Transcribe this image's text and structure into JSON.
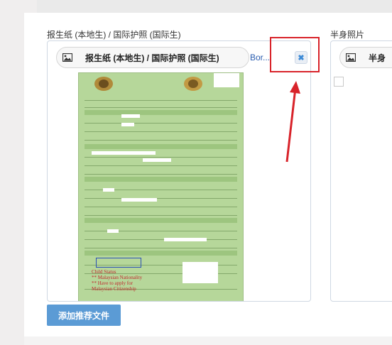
{
  "form": {
    "field1_label": "报生纸 (本地生) / 国际护照 (国际生)",
    "field2_label": "半身照片"
  },
  "upload1": {
    "file_label": "报生纸 (本地生) / 国际护照 (国际生)",
    "file_link": "Bor...",
    "remove_symbol": "✖"
  },
  "upload2": {
    "file_label": "半身"
  },
  "document_preview": {
    "handwritten_note": [
      "Child Status",
      "** Malaysian Nationality",
      "** Have to apply for",
      "Malaysian Citizenship"
    ]
  },
  "buttons": {
    "add_recommended_file": "添加推荐文件"
  },
  "icons": {
    "pill_icon": "image-icon",
    "remove_icon": "close-icon"
  },
  "colors": {
    "annotation": "#d8232a",
    "button": "#5b9bd5",
    "document_background": "#b6d79a"
  }
}
